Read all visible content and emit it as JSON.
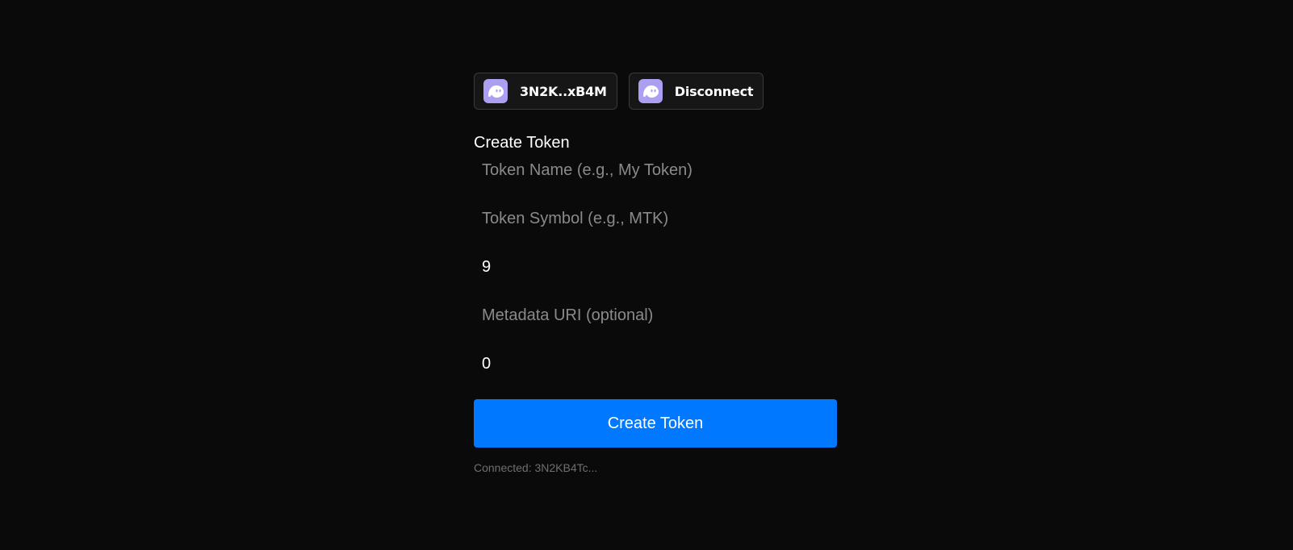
{
  "wallet": {
    "address_label": "3N2K..xB4M",
    "disconnect_label": "Disconnect",
    "icon": "phantom-ghost-icon",
    "icon_color": "#ab9ff2"
  },
  "form": {
    "title": "Create Token",
    "token_name": {
      "value": "",
      "placeholder": "Token Name (e.g., My Token)"
    },
    "token_symbol": {
      "value": "",
      "placeholder": "Token Symbol (e.g., MTK)"
    },
    "decimals": {
      "value": "9",
      "placeholder": ""
    },
    "metadata_uri": {
      "value": "",
      "placeholder": "Metadata URI (optional)"
    },
    "initial_supply": {
      "value": "0",
      "placeholder": ""
    },
    "submit_label": "Create Token",
    "submit_color": "#0078ff"
  },
  "status": {
    "text": "Connected: 3N2KB4Tc..."
  }
}
